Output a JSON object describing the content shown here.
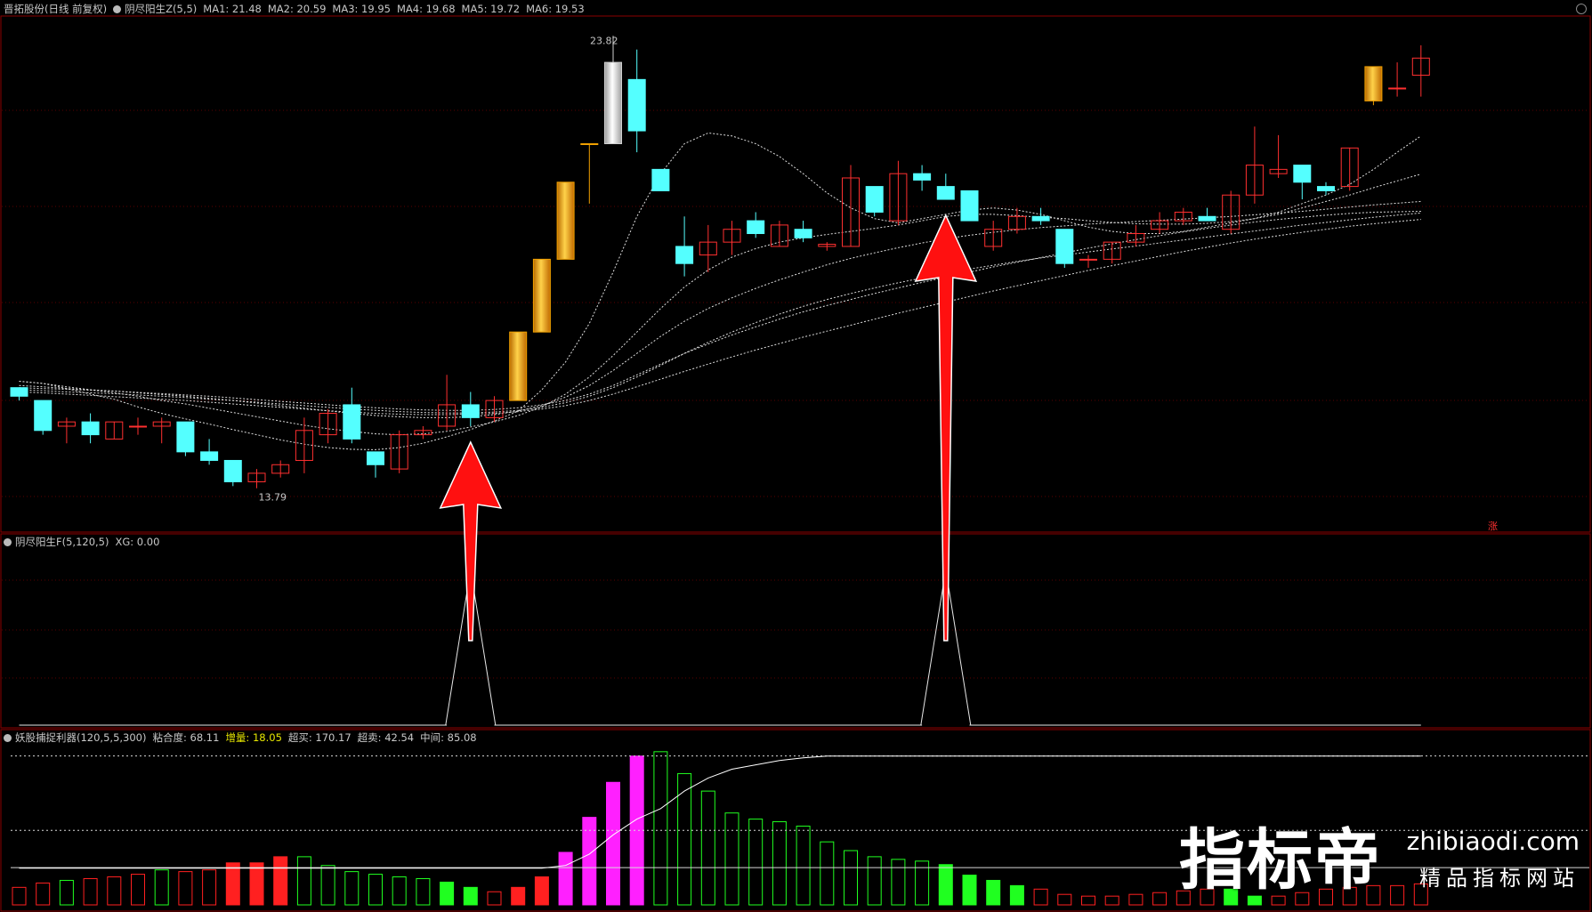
{
  "panel1": {
    "stock": "晋拓股份(日线 前复权)",
    "indicator": "阴尽阳生Z(5,5)",
    "ma": [
      "MA1: 21.48",
      "MA2: 20.59",
      "MA3: 19.95",
      "MA4: 19.68",
      "MA5: 19.72",
      "MA6: 19.53"
    ],
    "high_label": "23.82",
    "low_label": "13.79",
    "tag": "涨"
  },
  "panel2": {
    "indicator": "阴尽阳生F(5,120,5)",
    "xg": "XG: 0.00"
  },
  "panel3": {
    "indicator": "妖股捕捉利器(120,5,5,300)",
    "items": [
      {
        "text": "粘合度: 68.11",
        "color": "#c8c8c8"
      },
      {
        "text": "增量: 18.05",
        "color": "#e8e800"
      },
      {
        "text": "超买: 170.17",
        "color": "#c8c8c8"
      },
      {
        "text": "超卖: 42.54",
        "color": "#c8c8c8"
      },
      {
        "text": "中间: 85.08",
        "color": "#c8c8c8"
      }
    ]
  },
  "watermark": {
    "brand": "指标帝",
    "url": "zhibiaodi.com",
    "slogan": "精品指标网站"
  },
  "colors": {
    "up": "#ff3030",
    "down": "#54ffff",
    "limit_up": "#f0a000",
    "ma_line": "#dddddd",
    "arrow": "#ff1010",
    "bar_red": "#ff2020",
    "bar_green": "#20ff20",
    "bar_magenta": "#ff20ff"
  },
  "chart_data": [
    {
      "type": "candlestick",
      "title": "晋拓股份(日线 前复权)",
      "ohlc": [
        [
          15.6,
          15.6,
          15.3,
          15.4
        ],
        [
          15.3,
          15.3,
          14.5,
          14.6
        ],
        [
          14.7,
          14.9,
          14.3,
          14.8
        ],
        [
          14.8,
          15.0,
          14.3,
          14.5
        ],
        [
          14.4,
          14.8,
          14.4,
          14.8
        ],
        [
          14.7,
          14.9,
          14.5,
          14.7
        ],
        [
          14.7,
          14.9,
          14.3,
          14.8
        ],
        [
          14.8,
          14.8,
          14.0,
          14.1
        ],
        [
          14.1,
          14.4,
          13.8,
          13.9
        ],
        [
          13.9,
          13.9,
          13.3,
          13.4
        ],
        [
          13.4,
          13.7,
          13.25,
          13.6
        ],
        [
          13.6,
          13.9,
          13.5,
          13.8
        ],
        [
          13.9,
          14.9,
          13.6,
          14.6
        ],
        [
          14.5,
          15.1,
          14.3,
          15.0
        ],
        [
          15.2,
          15.6,
          14.3,
          14.4
        ],
        [
          14.1,
          14.1,
          13.5,
          13.8
        ],
        [
          13.7,
          14.6,
          13.6,
          14.5
        ],
        [
          14.5,
          14.7,
          14.4,
          14.6
        ],
        [
          14.7,
          15.9,
          14.6,
          15.2
        ],
        [
          15.2,
          15.5,
          14.7,
          14.9
        ],
        [
          14.9,
          15.4,
          14.8,
          15.3
        ],
        [
          15.3,
          16.9,
          15.3,
          16.9
        ],
        [
          16.9,
          18.6,
          16.9,
          18.6
        ],
        [
          18.6,
          20.4,
          18.6,
          20.4
        ],
        [
          21.3,
          21.3,
          19.9,
          21.3
        ],
        [
          21.3,
          23.82,
          21.3,
          23.2
        ],
        [
          22.8,
          23.5,
          21.1,
          21.6
        ],
        [
          20.7,
          20.7,
          20.2,
          20.2
        ],
        [
          18.9,
          19.6,
          18.2,
          18.5
        ],
        [
          18.7,
          19.4,
          18.3,
          19.0
        ],
        [
          19.0,
          19.5,
          18.7,
          19.3
        ],
        [
          19.5,
          19.7,
          19.1,
          19.2
        ],
        [
          18.9,
          19.5,
          18.9,
          19.4
        ],
        [
          19.3,
          19.5,
          19.0,
          19.1
        ],
        [
          18.9,
          19.0,
          18.8,
          18.95
        ],
        [
          18.9,
          20.8,
          18.9,
          20.5
        ],
        [
          20.3,
          20.3,
          19.6,
          19.7
        ],
        [
          19.5,
          20.9,
          19.4,
          20.6
        ],
        [
          20.6,
          20.8,
          20.2,
          20.45
        ],
        [
          20.3,
          20.6,
          20.0,
          20.0
        ],
        [
          20.2,
          20.2,
          19.5,
          19.5
        ],
        [
          18.9,
          19.5,
          18.8,
          19.3
        ],
        [
          19.3,
          19.8,
          19.2,
          19.6
        ],
        [
          19.6,
          19.8,
          19.4,
          19.5
        ],
        [
          19.3,
          19.3,
          18.4,
          18.5
        ],
        [
          18.6,
          18.7,
          18.4,
          18.6
        ],
        [
          18.6,
          19.0,
          18.5,
          19.0
        ],
        [
          19.0,
          19.4,
          18.9,
          19.2
        ],
        [
          19.3,
          19.7,
          19.2,
          19.5
        ],
        [
          19.5,
          19.8,
          19.4,
          19.7
        ],
        [
          19.6,
          19.8,
          19.5,
          19.5
        ],
        [
          19.3,
          20.2,
          19.2,
          20.1
        ],
        [
          20.1,
          21.7,
          19.9,
          20.8
        ],
        [
          20.6,
          21.5,
          20.5,
          20.7
        ],
        [
          20.8,
          20.8,
          20.0,
          20.4
        ],
        [
          20.3,
          20.4,
          20.1,
          20.2
        ],
        [
          20.3,
          21.2,
          20.2,
          21.2
        ],
        [
          23.1,
          23.1,
          22.2,
          22.3
        ],
        [
          22.6,
          23.2,
          22.4,
          22.6
        ],
        [
          22.9,
          23.6,
          22.4,
          23.3
        ]
      ],
      "limit_up_candles": [
        21,
        22,
        23,
        24,
        57
      ],
      "grey_candle": 25,
      "ylim": [
        12.6,
        24.2
      ],
      "ma_lines": [
        [
          15.75,
          15.7,
          15.58,
          15.45,
          15.33,
          15.15,
          15.0,
          14.87,
          14.75,
          14.62,
          14.5,
          14.38,
          14.28,
          14.2,
          14.16,
          14.15,
          14.2,
          14.3,
          14.45,
          14.62,
          14.82,
          15.05,
          15.55,
          16.2,
          17.1,
          18.3,
          19.6,
          20.6,
          21.3,
          21.55,
          21.48,
          21.3,
          21.0,
          20.6,
          20.15,
          19.8,
          19.55,
          19.45,
          19.55,
          19.65,
          19.75,
          19.8,
          19.75,
          19.65,
          19.5,
          19.35,
          19.25,
          19.2,
          19.2,
          19.25,
          19.35,
          19.45,
          19.55,
          19.7,
          19.9,
          20.1,
          20.35,
          20.7,
          21.1,
          21.48
        ],
        [
          15.75,
          15.7,
          15.62,
          15.55,
          15.48,
          15.4,
          15.3,
          15.22,
          15.12,
          15.02,
          14.92,
          14.82,
          14.72,
          14.64,
          14.58,
          14.52,
          14.5,
          14.52,
          14.58,
          14.68,
          14.8,
          14.95,
          15.15,
          15.45,
          15.85,
          16.35,
          16.9,
          17.45,
          17.95,
          18.35,
          18.65,
          18.85,
          19.0,
          19.1,
          19.18,
          19.25,
          19.32,
          19.4,
          19.5,
          19.6,
          19.65,
          19.65,
          19.62,
          19.58,
          19.55,
          19.5,
          19.46,
          19.43,
          19.42,
          19.42,
          19.44,
          19.48,
          19.55,
          19.65,
          19.8,
          19.95,
          20.1,
          20.27,
          20.43,
          20.59
        ],
        [
          15.65,
          15.62,
          15.58,
          15.55,
          15.52,
          15.48,
          15.44,
          15.4,
          15.35,
          15.3,
          15.24,
          15.18,
          15.12,
          15.06,
          15.0,
          14.95,
          14.92,
          14.9,
          14.9,
          14.92,
          14.97,
          15.05,
          15.18,
          15.38,
          15.65,
          16.0,
          16.4,
          16.8,
          17.15,
          17.45,
          17.7,
          17.92,
          18.12,
          18.3,
          18.47,
          18.62,
          18.75,
          18.87,
          18.98,
          19.08,
          19.16,
          19.23,
          19.29,
          19.34,
          19.38,
          19.42,
          19.45,
          19.48,
          19.51,
          19.54,
          19.57,
          19.6,
          19.64,
          19.68,
          19.72,
          19.77,
          19.82,
          19.87,
          19.91,
          19.95
        ],
        [
          15.55,
          15.53,
          15.5,
          15.48,
          15.46,
          15.43,
          15.4,
          15.37,
          15.33,
          15.3,
          15.26,
          15.22,
          15.18,
          15.14,
          15.1,
          15.07,
          15.04,
          15.02,
          15.01,
          15.01,
          15.03,
          15.07,
          15.14,
          15.25,
          15.4,
          15.6,
          15.85,
          16.12,
          16.4,
          16.66,
          16.9,
          17.12,
          17.32,
          17.5,
          17.66,
          17.8,
          17.93,
          18.05,
          18.16,
          18.27,
          18.37,
          18.46,
          18.55,
          18.63,
          18.7,
          18.77,
          18.84,
          18.91,
          18.98,
          19.05,
          19.12,
          19.19,
          19.26,
          19.33,
          19.4,
          19.46,
          19.52,
          19.58,
          19.63,
          19.68
        ],
        [
          15.6,
          15.58,
          15.56,
          15.54,
          15.52,
          15.49,
          15.46,
          15.43,
          15.4,
          15.36,
          15.32,
          15.28,
          15.24,
          15.2,
          15.16,
          15.13,
          15.1,
          15.08,
          15.07,
          15.07,
          15.09,
          15.13,
          15.2,
          15.3,
          15.45,
          15.65,
          15.9,
          16.15,
          16.4,
          16.62,
          16.83,
          17.02,
          17.2,
          17.37,
          17.52,
          17.66,
          17.8,
          17.93,
          18.06,
          18.18,
          18.3,
          18.42,
          18.53,
          18.64,
          18.75,
          18.86,
          18.96,
          19.06,
          19.15,
          19.24,
          19.32,
          19.4,
          19.47,
          19.53,
          19.58,
          19.63,
          19.67,
          19.7,
          19.71,
          19.72
        ],
        [
          15.5,
          15.48,
          15.45,
          15.42,
          15.39,
          15.36,
          15.33,
          15.3,
          15.26,
          15.22,
          15.18,
          15.14,
          15.1,
          15.06,
          15.03,
          15.0,
          14.98,
          14.97,
          14.97,
          14.98,
          15.0,
          15.04,
          15.1,
          15.18,
          15.3,
          15.45,
          15.62,
          15.8,
          15.98,
          16.15,
          16.32,
          16.48,
          16.63,
          16.78,
          16.92,
          17.06,
          17.2,
          17.34,
          17.47,
          17.6,
          17.73,
          17.86,
          17.98,
          18.1,
          18.22,
          18.34,
          18.45,
          18.56,
          18.67,
          18.78,
          18.88,
          18.98,
          19.07,
          19.15,
          19.23,
          19.3,
          19.37,
          19.43,
          19.48,
          19.53
        ]
      ]
    },
    {
      "type": "line",
      "title": "阴尽阳生F(5,120,5)",
      "values": [
        0,
        0,
        0,
        0,
        0,
        0,
        0,
        0,
        0,
        0,
        0,
        0,
        0,
        0,
        0,
        0,
        0,
        0,
        0,
        1,
        0,
        0,
        0,
        0,
        0,
        0,
        0,
        0,
        0,
        0,
        0,
        0,
        0,
        0,
        0,
        0,
        0,
        0,
        0,
        1,
        0,
        0,
        0,
        0,
        0,
        0,
        0,
        0,
        0,
        0,
        0,
        0,
        0,
        0,
        0,
        0,
        0,
        0,
        0,
        0
      ]
    },
    {
      "type": "bar",
      "title": "妖股捕捉利器(120,5,5,300)",
      "values": [
        20,
        25,
        28,
        30,
        32,
        35,
        40,
        38,
        40,
        48,
        48,
        55,
        55,
        45,
        38,
        35,
        32,
        30,
        26,
        20,
        15,
        20,
        32,
        60,
        100,
        140,
        170,
        175,
        150,
        130,
        105,
        98,
        95,
        90,
        72,
        62,
        55,
        52,
        50,
        46,
        34,
        28,
        22,
        18,
        12,
        10,
        10,
        12,
        14,
        16,
        18,
        18,
        10,
        10,
        14,
        18,
        20,
        22,
        22,
        24
      ],
      "colors": [
        "o",
        "o",
        "g",
        "o",
        "o",
        "o",
        "g",
        "o",
        "o",
        "r",
        "r",
        "r",
        "g",
        "g",
        "g",
        "g",
        "g",
        "g",
        "G",
        "G",
        "o",
        "r",
        "r",
        "m",
        "m",
        "m",
        "m",
        "g",
        "g",
        "g",
        "g",
        "g",
        "g",
        "g",
        "g",
        "g",
        "g",
        "g",
        "g",
        "G",
        "G",
        "G",
        "G",
        "o",
        "o",
        "o",
        "o",
        "o",
        "o",
        "o",
        "o",
        "G",
        "G",
        "o",
        "o",
        "o",
        "o",
        "o",
        "o",
        "o"
      ],
      "ylim": [
        0,
        185
      ],
      "overbought": 170.17,
      "oversold": 42.54,
      "midline": 85.08,
      "curve": [
        42,
        42,
        42,
        42,
        42,
        42,
        42,
        42,
        42,
        42,
        42,
        42,
        42,
        42,
        42,
        42,
        42,
        42,
        42,
        42,
        42,
        42,
        42,
        45,
        58,
        80,
        98,
        110,
        130,
        145,
        155,
        160,
        165,
        168,
        170,
        170,
        170,
        170,
        170,
        170,
        170,
        170,
        170,
        170,
        170,
        170,
        170,
        170,
        170,
        170,
        170,
        170,
        170,
        170,
        170,
        170,
        170,
        170,
        170,
        170
      ]
    }
  ]
}
